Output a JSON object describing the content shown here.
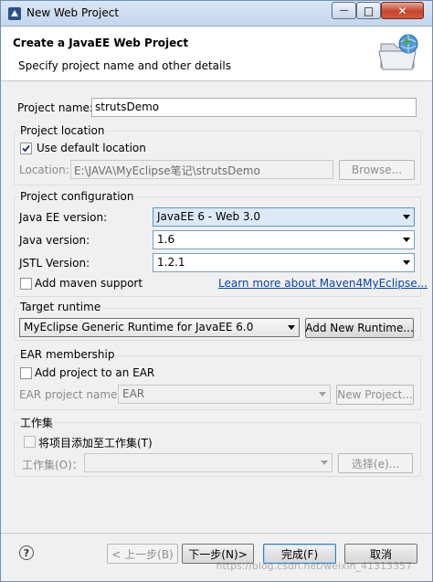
{
  "window": {
    "title": "New Web Project",
    "minimize_glyph": "—",
    "maximize_glyph": "□",
    "close_glyph": "✕"
  },
  "header": {
    "title": "Create a JavaEE Web Project",
    "subtitle": "Specify project name and other details",
    "icon": "web-project-folder-icon"
  },
  "project_name": {
    "label": "Project name:",
    "value": "strutsDemo"
  },
  "project_location": {
    "group_title": "Project location",
    "use_default_label": "Use default location",
    "use_default_checked": true,
    "location_label": "Location:",
    "location_value": "E:\\JAVA\\MyEclipse笔记\\strutsDemo",
    "browse_label": "Browse..."
  },
  "project_configuration": {
    "group_title": "Project configuration",
    "java_ee_label": "Java EE version:",
    "java_ee_value": "JavaEE 6 - Web 3.0",
    "java_label": "Java version:",
    "java_value": "1.6",
    "jstl_label": "JSTL Version:",
    "jstl_value": "1.2.1",
    "maven_label": "Add maven support",
    "maven_checked": false,
    "maven_link": "Learn more about Maven4MyEclipse..."
  },
  "target_runtime": {
    "group_title": "Target runtime",
    "value": "MyEclipse Generic Runtime for JavaEE 6.0",
    "add_button": "Add New Runtime..."
  },
  "ear_membership": {
    "group_title": "EAR membership",
    "add_label": "Add project to an EAR",
    "add_checked": false,
    "ear_name_label": "EAR project name:",
    "ear_name_value": "EAR",
    "new_project_button": "New Project..."
  },
  "working_set": {
    "group_title": "工作集",
    "add_label": "将项目添加至工作集(T)",
    "add_checked": false,
    "set_label": "工作集(O)：",
    "set_value": "",
    "select_button": "选择(e)..."
  },
  "footer": {
    "back_button": "< 上一步(B)",
    "next_button": "下一步(N)>",
    "finish_button": "完成(F)",
    "cancel_button": "取消",
    "watermark": "https://blog.csdn.net/weixin_41313357"
  },
  "colors": {
    "link": "#0645ad",
    "combo_highlight": "#dce9f7",
    "close_button": "#c7452c"
  }
}
